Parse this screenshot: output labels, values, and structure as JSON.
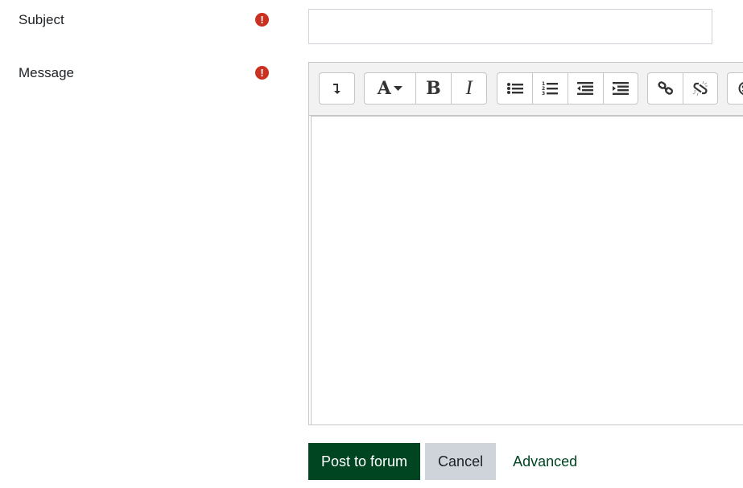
{
  "form": {
    "subject": {
      "label": "Subject",
      "value": "",
      "placeholder": "",
      "required_icon": "exclamation-circle-icon"
    },
    "message": {
      "label": "Message",
      "value": "",
      "required_icon": "exclamation-circle-icon"
    }
  },
  "editor": {
    "toolbar": [
      {
        "group": "toggle",
        "buttons": [
          {
            "name": "show-more-buttons",
            "icon": "arrow-down-icon",
            "glyph": "↴"
          }
        ]
      },
      {
        "group": "style",
        "buttons": [
          {
            "name": "paragraph-styles",
            "icon": "font-a-icon",
            "glyph": "A"
          },
          {
            "name": "bold",
            "icon": "bold-icon",
            "glyph": "B"
          },
          {
            "name": "italic",
            "icon": "italic-icon",
            "glyph": "I"
          }
        ]
      },
      {
        "group": "list",
        "buttons": [
          {
            "name": "unordered-list",
            "icon": "bullet-list-icon"
          },
          {
            "name": "ordered-list",
            "icon": "numbered-list-icon"
          },
          {
            "name": "outdent",
            "icon": "outdent-icon"
          },
          {
            "name": "indent",
            "icon": "indent-icon"
          }
        ]
      },
      {
        "group": "links",
        "buttons": [
          {
            "name": "link",
            "icon": "link-icon"
          },
          {
            "name": "unlink",
            "icon": "unlink-icon"
          }
        ]
      },
      {
        "group": "more",
        "buttons": [
          {
            "name": "emoji",
            "icon": "emoji-icon"
          }
        ]
      }
    ]
  },
  "actions": {
    "submit_label": "Post to forum",
    "cancel_label": "Cancel",
    "advanced_label": "Advanced"
  },
  "colors": {
    "primary": "#004522",
    "required": "#ca3120",
    "secondary": "#ced4da"
  }
}
